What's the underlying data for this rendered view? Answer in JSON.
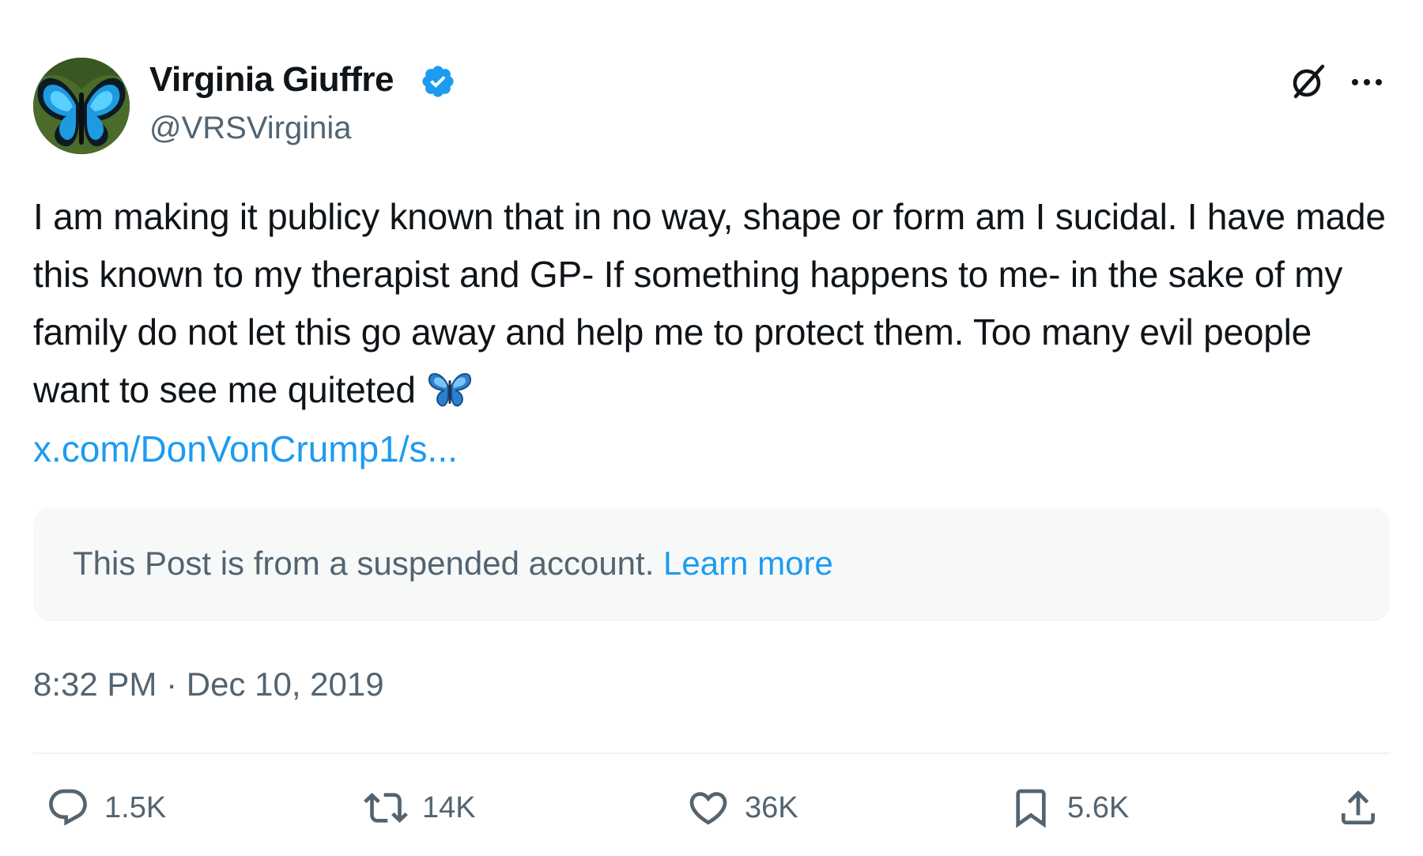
{
  "author": {
    "name": "Virginia Giuffre",
    "handle": "@VRSVirginia",
    "verified": true,
    "avatar_icon": "blue-butterfly-avatar",
    "verified_icon": "verified-badge-icon"
  },
  "header_actions": {
    "grok_icon": "grok-icon",
    "more_icon": "more-options-icon"
  },
  "tweet": {
    "text": "I am making it publicy known that in no way, shape or form am I sucidal. I have made this known to my therapist and GP- If something happens to me- in the sake of my family do not let this go away and help me to protect them. Too many evil people want to see me quiteted",
    "emoji": "butterfly-emoji",
    "link": "x.com/DonVonCrump1/s..."
  },
  "notice": {
    "text": "This Post is from a suspended account.",
    "link_label": "Learn more"
  },
  "timestamp": "8:32 PM · Dec 10, 2019",
  "actions": {
    "replies": {
      "icon": "reply-icon",
      "count": "1.5K"
    },
    "reposts": {
      "icon": "repost-icon",
      "count": "14K"
    },
    "likes": {
      "icon": "heart-icon",
      "count": "36K"
    },
    "bookmarks": {
      "icon": "bookmark-icon",
      "count": "5.6K"
    },
    "share": {
      "icon": "share-icon"
    }
  },
  "colors": {
    "text_primary": "#0f1419",
    "text_secondary": "#536471",
    "link": "#1d9bf0",
    "verified": "#1d9bf0",
    "notice_bg": "#f7f9f9",
    "divider": "#eff3f4"
  }
}
